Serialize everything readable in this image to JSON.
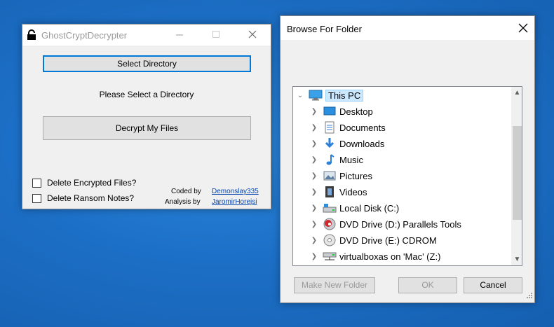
{
  "decrypter_window": {
    "title": "GhostCryptDecrypter",
    "select_button": "Select Directory",
    "status_label": "Please Select a Directory",
    "decrypt_button": "Decrypt My Files",
    "checkbox_delete_encrypted": "Delete Encrypted Files?",
    "checkbox_delete_notes": "Delete Ransom Notes?",
    "coded_by_label": "Coded by",
    "coded_by_link": "Demonslay335",
    "analysis_by_label": "Analysis by",
    "analysis_by_link": "JaromirHorejsi"
  },
  "browse_window": {
    "title": "Browse For Folder",
    "tree": {
      "root": "This PC",
      "items": [
        {
          "label": "Desktop",
          "icon": "desktop-icon"
        },
        {
          "label": "Documents",
          "icon": "documents-icon"
        },
        {
          "label": "Downloads",
          "icon": "downloads-icon"
        },
        {
          "label": "Music",
          "icon": "music-icon"
        },
        {
          "label": "Pictures",
          "icon": "pictures-icon"
        },
        {
          "label": "Videos",
          "icon": "videos-icon"
        },
        {
          "label": "Local Disk (C:)",
          "icon": "local-disk-icon"
        },
        {
          "label": "DVD Drive (D:) Parallels Tools",
          "icon": "dvd-drive-icon"
        },
        {
          "label": "DVD Drive (E:) CDROM",
          "icon": "cdrom-icon"
        },
        {
          "label": "virtualboxas on 'Mac' (Z:)",
          "icon": "network-drive-icon"
        }
      ]
    },
    "buttons": {
      "make_new_folder": "Make New Folder",
      "ok": "OK",
      "cancel": "Cancel"
    }
  },
  "colors": {
    "desktop_background": "#1a6bc4",
    "accent": "#0078d7",
    "selection": "#cce8ff",
    "link": "#0645ad"
  }
}
